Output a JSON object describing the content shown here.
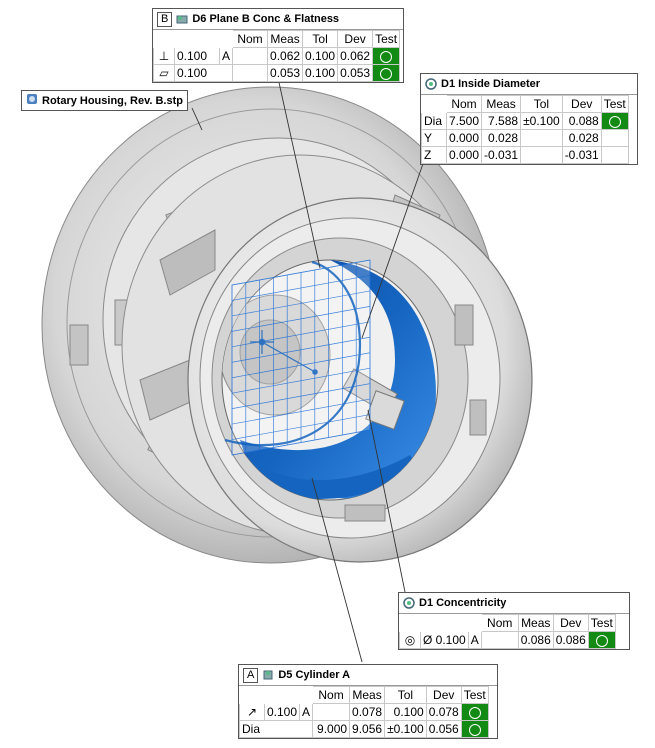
{
  "model": {
    "label": "Rotary Housing, Rev. B.stp",
    "icon": "cad-part-icon"
  },
  "callouts": {
    "d6": {
      "datum": "B",
      "title": "D6 Plane B Conc & Flatness",
      "icon": "plane-feature-icon",
      "headers": [
        "Nom",
        "Meas",
        "Tol",
        "Dev",
        "Test"
      ],
      "rows": [
        {
          "symbol": "perpendicularity-icon",
          "tol_zone": "0.100",
          "datum_ref": "A",
          "nom": "",
          "meas": "0.062",
          "tol": "0.100",
          "dev": "0.062",
          "test": "pass"
        },
        {
          "symbol": "flatness-icon",
          "tol_zone": "0.100",
          "datum_ref": "",
          "nom": "",
          "meas": "0.053",
          "tol": "0.100",
          "dev": "0.053",
          "test": "pass"
        }
      ]
    },
    "d1_dia": {
      "title": "D1 Inside Diameter",
      "icon": "circle-feature-icon",
      "headers": [
        "Nom",
        "Meas",
        "Tol",
        "Dev",
        "Test"
      ],
      "rows": [
        {
          "label": "Dia",
          "nom": "7.500",
          "meas": "7.588",
          "tol": "±0.100",
          "dev": "0.088",
          "test": "pass"
        },
        {
          "label": "Y",
          "nom": "0.000",
          "meas": "0.028",
          "tol": "",
          "dev": "0.028",
          "test": ""
        },
        {
          "label": "Z",
          "nom": "0.000",
          "meas": "-0.031",
          "tol": "",
          "dev": "-0.031",
          "test": ""
        }
      ]
    },
    "d1_conc": {
      "title": "D1 Concentricity",
      "icon": "circle-feature-icon",
      "headers": [
        "Nom",
        "Meas",
        "Dev",
        "Test"
      ],
      "rows": [
        {
          "symbol": "concentricity-icon",
          "tol_zone": "Ø 0.100",
          "datum_ref": "A",
          "nom": "",
          "meas": "0.086",
          "dev": "0.086",
          "test": "pass"
        }
      ]
    },
    "d5": {
      "datum": "A",
      "title": "D5 Cylinder A",
      "icon": "cylinder-feature-icon",
      "headers": [
        "Nom",
        "Meas",
        "Tol",
        "Dev",
        "Test"
      ],
      "rows": [
        {
          "symbol": "circular-runout-icon",
          "tol_zone": "0.100",
          "datum_ref": "A",
          "nom": "",
          "meas": "0.078",
          "tol": "0.100",
          "dev": "0.078",
          "test": "pass"
        },
        {
          "label": "Dia",
          "nom": "9.000",
          "meas": "9.056",
          "tol": "±0.100",
          "dev": "0.056",
          "test": "pass"
        }
      ]
    }
  },
  "colors": {
    "pass": "#138a13",
    "measured_surface": "#1565c0",
    "part_gray": "#d8d8d8"
  }
}
